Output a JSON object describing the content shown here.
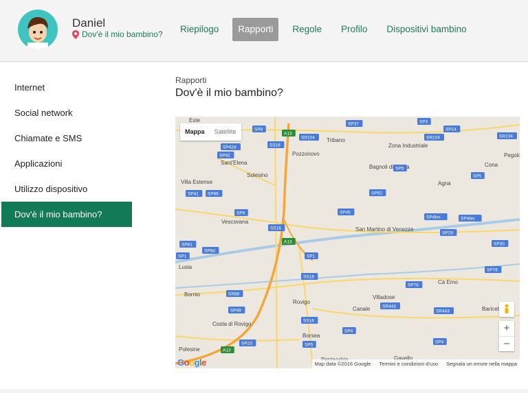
{
  "user": {
    "name": "Daniel",
    "location_label": "Dov'è il mio bambino?"
  },
  "nav": [
    "Riepilogo",
    "Rapporti",
    "Regole",
    "Profilo",
    "Dispositivi bambino"
  ],
  "nav_active": "Rapporti",
  "sidebar": [
    {
      "label": "Internet"
    },
    {
      "label": "Social network"
    },
    {
      "label": "Chiamate e SMS"
    },
    {
      "label": "Applicazioni"
    },
    {
      "label": "Utilizzo dispositivo"
    },
    {
      "label": "Dov'è il mio bambino?",
      "active": true
    }
  ],
  "page": {
    "breadcrumb": "Rapporti",
    "title": "Dov'è il mio bambino?"
  },
  "map": {
    "toggle": {
      "map": "Mappa",
      "satellite": "Satellite"
    },
    "zoom_in": "+",
    "zoom_out": "−",
    "footer": [
      "Map data ©2016 Google",
      "Termini e condizioni d'uso",
      "Segnala un errore nella mappa"
    ],
    "places": [
      "Este",
      "Tribano",
      "Zona Industriale",
      "Pegolotte",
      "Pozzonovo",
      "Sant'Elena",
      "Bagnoli di Sopra",
      "Cona",
      "Solesino",
      "Agna",
      "Villa Estense",
      "Vescovana",
      "San Martino di Venezze",
      "Lusia",
      "Cà Emo",
      "Bornio",
      "Villadose",
      "Rovigo",
      "Canale",
      "Baricetta",
      "Costa di Rovigo",
      "Borsea",
      "Polesine",
      "Pontecchio",
      "Gavello"
    ],
    "roads": [
      "SP37",
      "SP3",
      "SP14",
      "SR104",
      "SP8",
      "A13",
      "SR104",
      "SR104",
      "SP42d",
      "SS16",
      "SP42",
      "SP5",
      "SP5",
      "SP41",
      "SP86",
      "SP92",
      "SP8",
      "SP45",
      "SP4bis",
      "SP4bis",
      "SS16",
      "SP29",
      "SP81",
      "A13",
      "SP30",
      "SP8d",
      "SP1",
      "SP1",
      "SS16",
      "SP78",
      "SP76",
      "SR88",
      "SR443",
      "SR443",
      "SP49",
      "SS16",
      "SP23",
      "SP4",
      "SP5",
      "SP4",
      "A13"
    ],
    "colors": {
      "highway": "#f4a63b",
      "road": "#fbd76a",
      "water": "#a9cbe6",
      "label": "#4a7bd8"
    }
  },
  "colors": {
    "accent": "#137a57",
    "nav_active_bg": "#9a9a9a"
  }
}
